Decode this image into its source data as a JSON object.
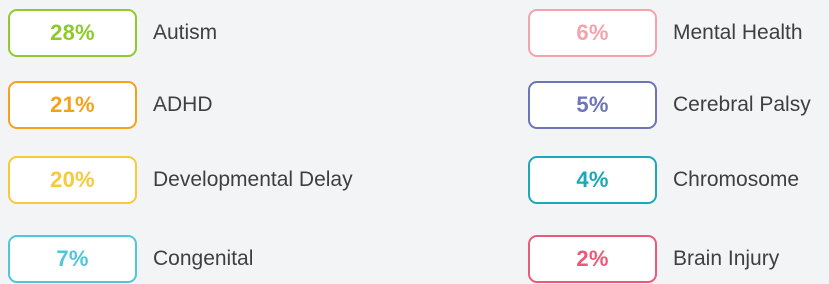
{
  "stats": [
    {
      "percent": "28%",
      "label": "Autism",
      "color": "#8ccb2b"
    },
    {
      "percent": "21%",
      "label": "ADHD",
      "color": "#f5a21b"
    },
    {
      "percent": "20%",
      "label": "Developmental Delay",
      "color": "#f8c93a"
    },
    {
      "percent": "7%",
      "label": "Congenital",
      "color": "#4fc7d9"
    },
    {
      "percent": "6%",
      "label": "Mental Health",
      "color": "#f4a3ad"
    },
    {
      "percent": "5%",
      "label": "Cerebral Palsy",
      "color": "#6d74b8"
    },
    {
      "percent": "4%",
      "label": "Chromosome",
      "color": "#1ba8b8"
    },
    {
      "percent": "2%",
      "label": "Brain Injury",
      "color": "#ea5a79"
    }
  ]
}
